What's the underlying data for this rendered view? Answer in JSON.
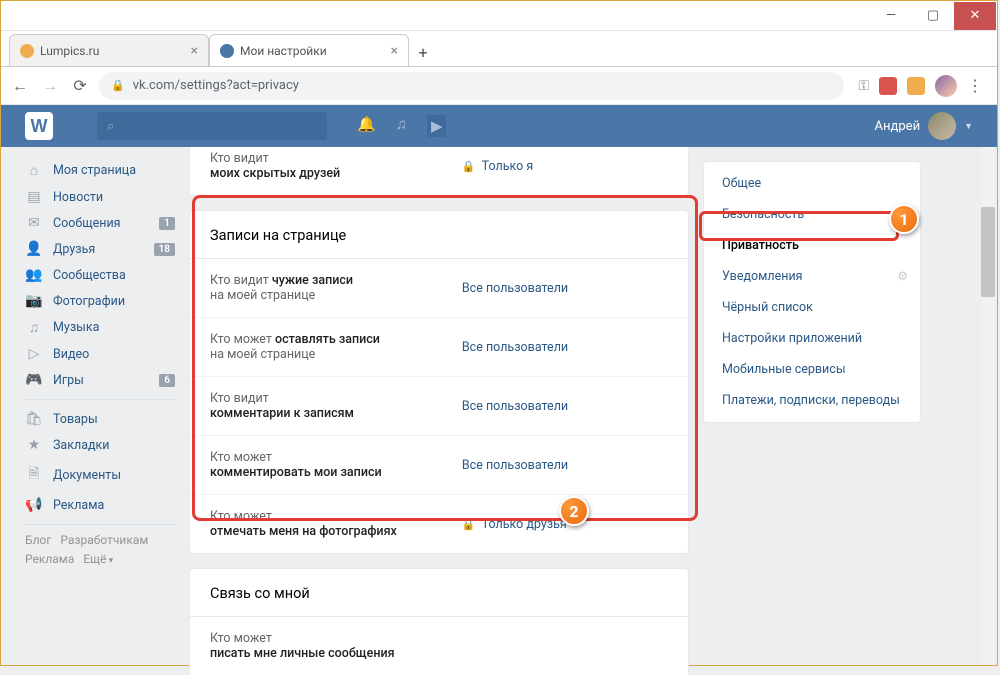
{
  "browser": {
    "tabs": [
      {
        "title": "Lumpics.ru",
        "favicon_color": "#f0ad4e"
      },
      {
        "title": "Мои настройки",
        "favicon_color": "#4a76a8"
      }
    ],
    "new_tab_icon": "+",
    "url": "vk.com/settings?act=privacy",
    "window_controls": {
      "min": "—",
      "max": "▢",
      "close": "✕"
    }
  },
  "vk_header": {
    "logo": "W",
    "search_icon": "⌕",
    "username": "Андрей"
  },
  "left_nav": {
    "items": [
      {
        "icon": "⌂",
        "label": "Моя страница"
      },
      {
        "icon": "▤",
        "label": "Новости"
      },
      {
        "icon": "✉",
        "label": "Сообщения",
        "badge": "1"
      },
      {
        "icon": "👤",
        "label": "Друзья",
        "badge": "18"
      },
      {
        "icon": "👥",
        "label": "Сообщества"
      },
      {
        "icon": "📷",
        "label": "Фотографии"
      },
      {
        "icon": "♫",
        "label": "Музыка"
      },
      {
        "icon": "▷",
        "label": "Видео"
      },
      {
        "icon": "🎮",
        "label": "Игры",
        "badge": "6"
      }
    ],
    "items2": [
      {
        "icon": "🛍",
        "label": "Товары"
      },
      {
        "icon": "★",
        "label": "Закладки"
      },
      {
        "icon": "🗎",
        "label": "Документы"
      },
      {
        "icon": "📢",
        "label": "Реклама"
      }
    ],
    "footer": {
      "blog": "Блог",
      "devs": "Разработчикам",
      "ads": "Реклама",
      "more": "Ещё"
    }
  },
  "center": {
    "top_partial": {
      "label_line1": "Кто видит",
      "label_line2": "моих скрытых друзей",
      "value": "Только я"
    },
    "section_title": "Записи на странице",
    "rows": [
      {
        "l1": "Кто видит ",
        "bold": "чужие записи",
        "l2": "на моей странице",
        "value": "Все пользователи",
        "lock": false
      },
      {
        "l1": "Кто может ",
        "bold": "оставлять записи",
        "l2": "на моей странице",
        "value": "Все пользователи",
        "lock": false
      },
      {
        "l1": "Кто видит",
        "bold": "комментарии к записям",
        "l2": "",
        "value": "Все пользователи",
        "lock": false
      },
      {
        "l1": "Кто может",
        "bold": "комментировать мои записи",
        "l2": "",
        "value": "Все пользователи",
        "lock": false
      },
      {
        "l1": "Кто может",
        "bold": "отмечать меня на фотографиях",
        "l2": "",
        "value": "Только друзья",
        "lock": true
      }
    ],
    "section2_title": "Связь со мной",
    "section2_row": {
      "l1": "Кто может",
      "bold": "писать мне личные сообщения"
    }
  },
  "right_menu": {
    "items": [
      {
        "label": "Общее"
      },
      {
        "label": "Безопасность"
      },
      {
        "label": "Приватность",
        "active": true
      },
      {
        "label": "Уведомления",
        "gear": true
      },
      {
        "label": "Чёрный список"
      },
      {
        "label": "Настройки приложений"
      },
      {
        "label": "Мобильные сервисы"
      },
      {
        "label": "Платежи, подписки, переводы"
      }
    ]
  },
  "annotations": {
    "n1": "1",
    "n2": "2"
  }
}
